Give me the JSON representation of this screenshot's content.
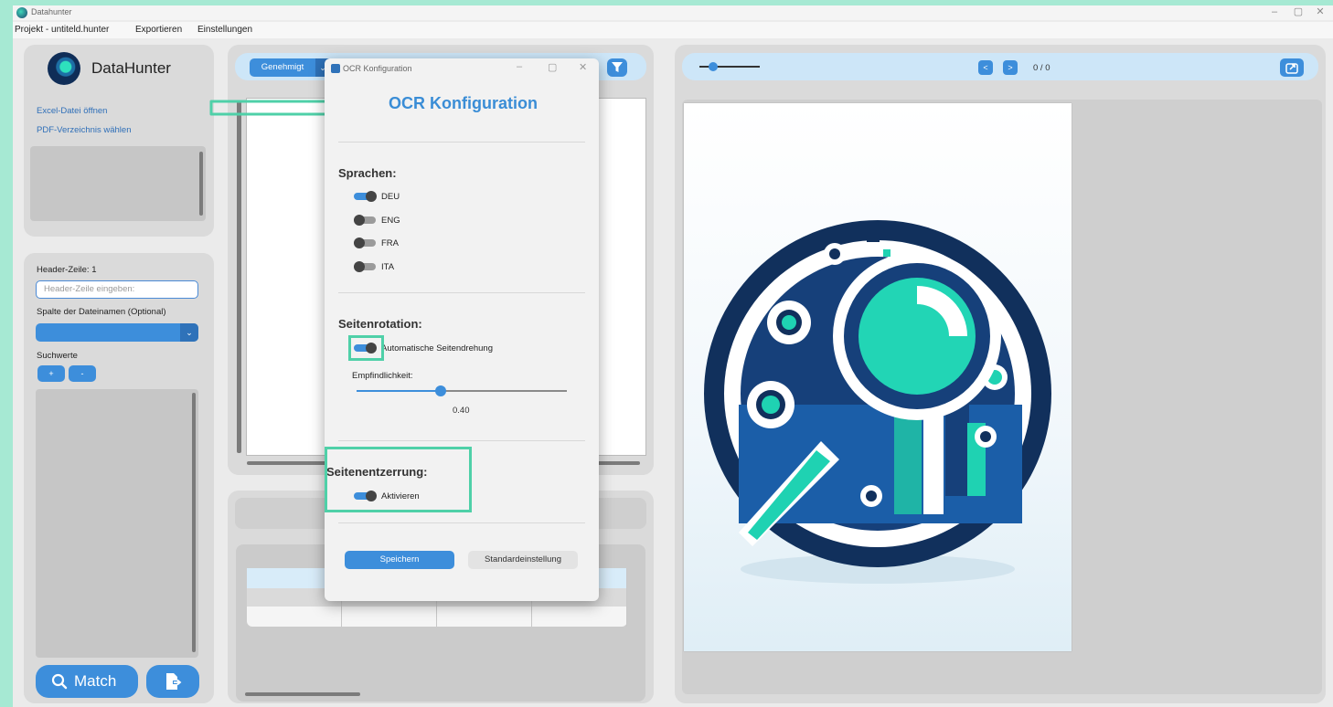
{
  "window": {
    "title": "Datahunter",
    "minimize_label": "–",
    "maximize_label": "▢",
    "close_label": "✕"
  },
  "menu": {
    "project": "Projekt - untiteld.hunter",
    "export": "Exportieren",
    "settings": "Einstellungen"
  },
  "sidebar": {
    "app_name": "DataHunter",
    "open_excel": "Excel-Datei öffnen",
    "choose_pdf_dir": "PDF-Verzeichnis wählen",
    "header_row_label": "Header-Zeile: 1",
    "header_row_placeholder": "Header-Zeile eingeben:",
    "filename_column_label": "Spalte der Dateinamen (Optional)",
    "dropdown_arrow": "⌄",
    "search_values_label": "Suchwerte",
    "add_label": "+",
    "remove_label": "-",
    "match_label": "Match"
  },
  "middle": {
    "status_select": "Genehmigt",
    "status_arrow": "⌄"
  },
  "viewer": {
    "prev_label": "<",
    "next_label": ">",
    "page_count": "0 / 0"
  },
  "dialog": {
    "window_title": "OCR Konfiguration",
    "heading": "OCR Konfiguration",
    "languages_title": "Sprachen:",
    "languages": [
      {
        "code": "DEU",
        "enabled": true
      },
      {
        "code": "ENG",
        "enabled": false
      },
      {
        "code": "FRA",
        "enabled": false
      },
      {
        "code": "ITA",
        "enabled": false
      }
    ],
    "rotation_title": "Seitenrotation:",
    "auto_rotation_label": "Automatische Seitendrehung",
    "auto_rotation_enabled": true,
    "sensitivity_label": "Empfindlichkeit:",
    "sensitivity_value": "0.40",
    "sensitivity_fraction": 0.4,
    "deskew_title": "Seitenentzerrung:",
    "deskew_label": "Aktivieren",
    "deskew_enabled": true,
    "save_label": "Speichern",
    "default_label": "Standardeinstellung"
  },
  "colors": {
    "accent": "#3d8edb",
    "annotation": "#4fd0a8",
    "background": "#a6e9d3"
  }
}
